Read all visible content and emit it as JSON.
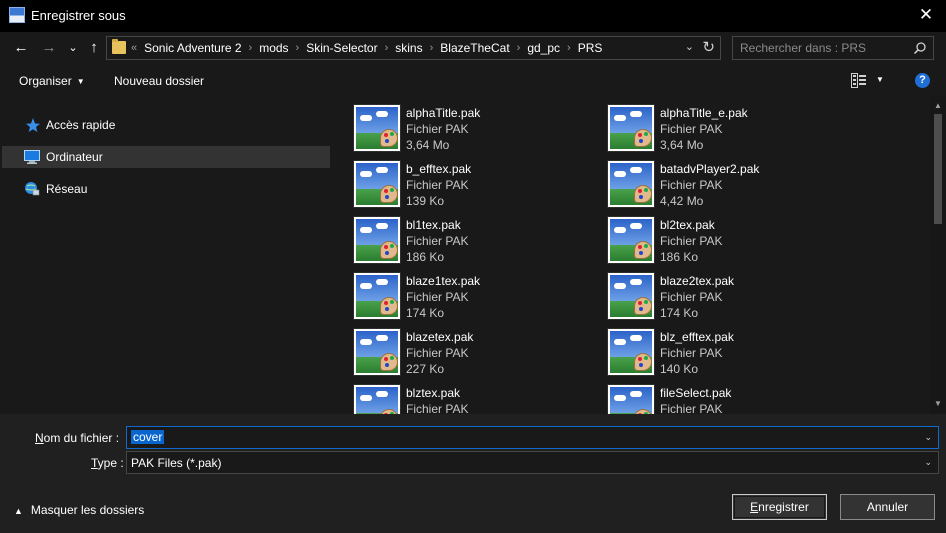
{
  "window": {
    "title": "Enregistrer sous",
    "close_glyph": "✕"
  },
  "nav": {
    "back": "←",
    "forward": "→",
    "recent": "⌄",
    "up": "↑",
    "breadcrumb_lead": "«",
    "breadcrumb": [
      "Sonic Adventure 2",
      "mods",
      "Skin-Selector",
      "skins",
      "BlazeTheCat",
      "gd_pc",
      "PRS"
    ],
    "breadcrumb_sep": "›",
    "address_chevron": "⌄",
    "refresh": "↻",
    "search_placeholder": "Rechercher dans : PRS"
  },
  "toolbar": {
    "organize": "Organiser",
    "new_folder": "Nouveau dossier",
    "caret": "▼",
    "help": "?"
  },
  "sidebar": {
    "items": [
      {
        "label": "Accès rapide",
        "icon": "star-icon"
      },
      {
        "label": "Ordinateur",
        "icon": "computer-icon"
      },
      {
        "label": "Réseau",
        "icon": "network-icon"
      }
    ]
  },
  "files": [
    {
      "name": "alphaTitle.pak",
      "type": "Fichier PAK",
      "size": "3,64 Mo"
    },
    {
      "name": "alphaTitle_e.pak",
      "type": "Fichier PAK",
      "size": "3,64 Mo"
    },
    {
      "name": "b_efftex.pak",
      "type": "Fichier PAK",
      "size": "139 Ko"
    },
    {
      "name": "batadvPlayer2.pak",
      "type": "Fichier PAK",
      "size": "4,42 Mo"
    },
    {
      "name": "bl1tex.pak",
      "type": "Fichier PAK",
      "size": "186 Ko"
    },
    {
      "name": "bl2tex.pak",
      "type": "Fichier PAK",
      "size": "186 Ko"
    },
    {
      "name": "blaze1tex.pak",
      "type": "Fichier PAK",
      "size": "174 Ko"
    },
    {
      "name": "blaze2tex.pak",
      "type": "Fichier PAK",
      "size": "174 Ko"
    },
    {
      "name": "blazetex.pak",
      "type": "Fichier PAK",
      "size": "227 Ko"
    },
    {
      "name": "blz_efftex.pak",
      "type": "Fichier PAK",
      "size": "140 Ko"
    },
    {
      "name": "blztex.pak",
      "type": "Fichier PAK",
      "size": ""
    },
    {
      "name": "fileSelect.pak",
      "type": "Fichier PAK",
      "size": ""
    }
  ],
  "scrollbar": {
    "up": "▲",
    "down": "▼"
  },
  "form": {
    "filename_label_prefix": "N",
    "filename_label_rest": "om du fichier :",
    "filename_value": "cover",
    "type_label_prefix": "T",
    "type_label_rest": "ype :",
    "type_value": "PAK Files (*.pak)",
    "dropdown_caret": "⌄"
  },
  "footer": {
    "hide_folders": "Masquer les dossiers",
    "hide_caret": "▲",
    "save_prefix": "E",
    "save_rest": "nregistrer",
    "cancel": "Annuler"
  },
  "colors": {
    "accent": "#0a66cf",
    "background": "#191919",
    "titlebar": "#000000",
    "footer": "#202020"
  }
}
